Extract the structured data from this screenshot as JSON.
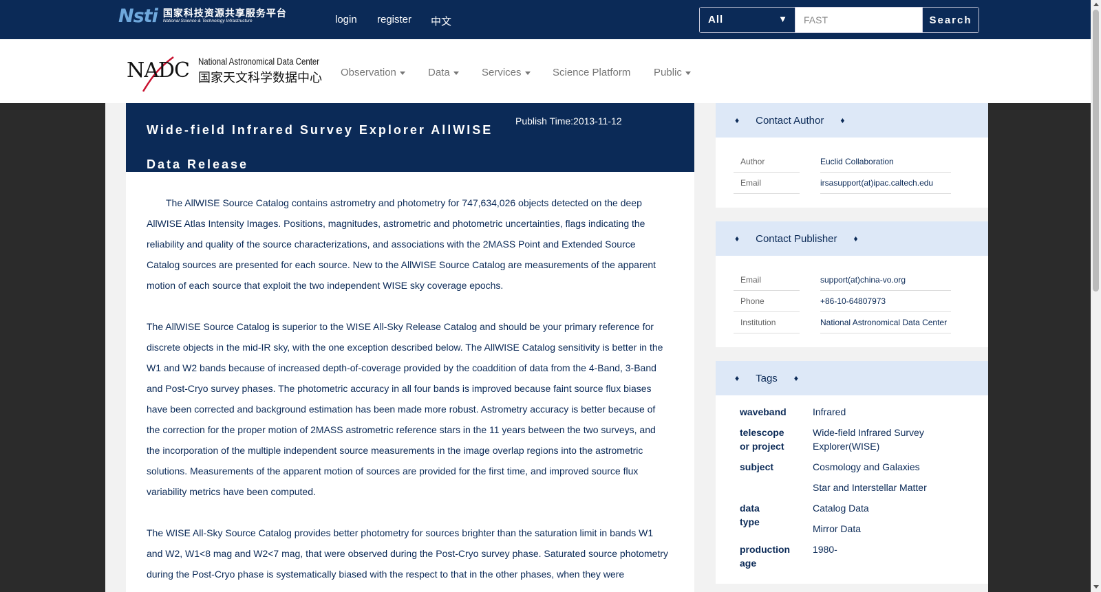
{
  "header": {
    "nsti_logo": {
      "mark": "Nsti",
      "cn": "国家科技资源共享服务平台",
      "en": "National Science & Technology Infrastructure"
    },
    "links": {
      "login": "login",
      "register": "register",
      "lang": "中文"
    },
    "search": {
      "scope": "All",
      "value": "FAST",
      "button": "Search"
    }
  },
  "nav": {
    "logo": {
      "mark": "NADC",
      "en": "National Astronomical Data Center",
      "cn": "国家天文科学数据中心"
    },
    "items": [
      "Observation",
      "Data",
      "Services",
      "Science Platform",
      "Public"
    ]
  },
  "dataset": {
    "title": "Wide-field Infrared Survey Explorer AllWISE Data Release",
    "publish_time": "Publish Time:2013-11-12",
    "paragraphs": [
      "The AllWISE Source Catalog contains astrometry and photometry for 747,634,026 objects detected on the deep AllWISE Atlas Intensity Images. Positions, magnitudes, astrometric and photometric uncertainties, flags indicating the reliability and quality of the source characterizations, and associations with the 2MASS Point and Extended Source Catalog sources are presented for each source. New to the AllWISE Source Catalog are measurements of the apparent motion of each source that exploit the two independent WISE sky coverage epochs.",
      "The AllWISE Source Catalog is superior to the WISE All-Sky Release Catalog and should be your primary reference for discrete objects in the mid-IR sky, with the one exception described below. The AllWISE Catalog sensitivity is better in the W1 and W2 bands because of increased depth-of-coverage provided by the coaddition of data from the 4-Band, 3-Band and Post-Cryo survey phases. The photometric accuracy in all four bands is improved because faint source flux biases have been corrected and background estimation has been made more robust. Astrometry accuracy is better because of the correction for the proper motion of 2MASS astrometric reference stars in the 11 years between the two surveys, and the incorporation of the multiple independent source measurements in the image overlap regions into the astrometric solutions. Measurements of the apparent motion of sources are provided for the first time, and improved source flux variability metrics have been computed.",
      "The WISE All-Sky Source Catalog provides better photometry for sources brighter than the saturation limit in bands W1 and W2, W1<8 mag and W2<7 mag, that were observed during the Post-Cryo survey phase. Saturated source photometry during the Post-Cryo phase is systematically biased with the respect to that in the other phases, when they were"
    ]
  },
  "sidebar": {
    "contact_author": {
      "title": "Contact Author",
      "rows": [
        {
          "key": "Author",
          "value": "Euclid Collaboration"
        },
        {
          "key": "Email",
          "value": "irsasupport(at)ipac.caltech.edu"
        }
      ]
    },
    "contact_publisher": {
      "title": "Contact Publisher",
      "rows": [
        {
          "key": "Email",
          "value": "support(at)china-vo.org"
        },
        {
          "key": "Phone",
          "value": "+86-10-64807973"
        },
        {
          "key": "Institution",
          "value": "National Astronomical Data Center"
        }
      ]
    },
    "tags": {
      "title": "Tags",
      "rows": [
        {
          "key": "waveband",
          "values": [
            "Infrared"
          ]
        },
        {
          "key": "telescope or project",
          "values": [
            "Wide-field Infrared Survey Explorer(WISE)"
          ]
        },
        {
          "key": "subject",
          "values": [
            "Cosmology and Galaxies",
            "Star and Interstellar Matter"
          ]
        },
        {
          "key": "data type",
          "values": [
            "Catalog Data",
            "Mirror Data"
          ]
        },
        {
          "key": "production age",
          "values": [
            "1980-"
          ]
        }
      ]
    },
    "diamond": "♦"
  }
}
